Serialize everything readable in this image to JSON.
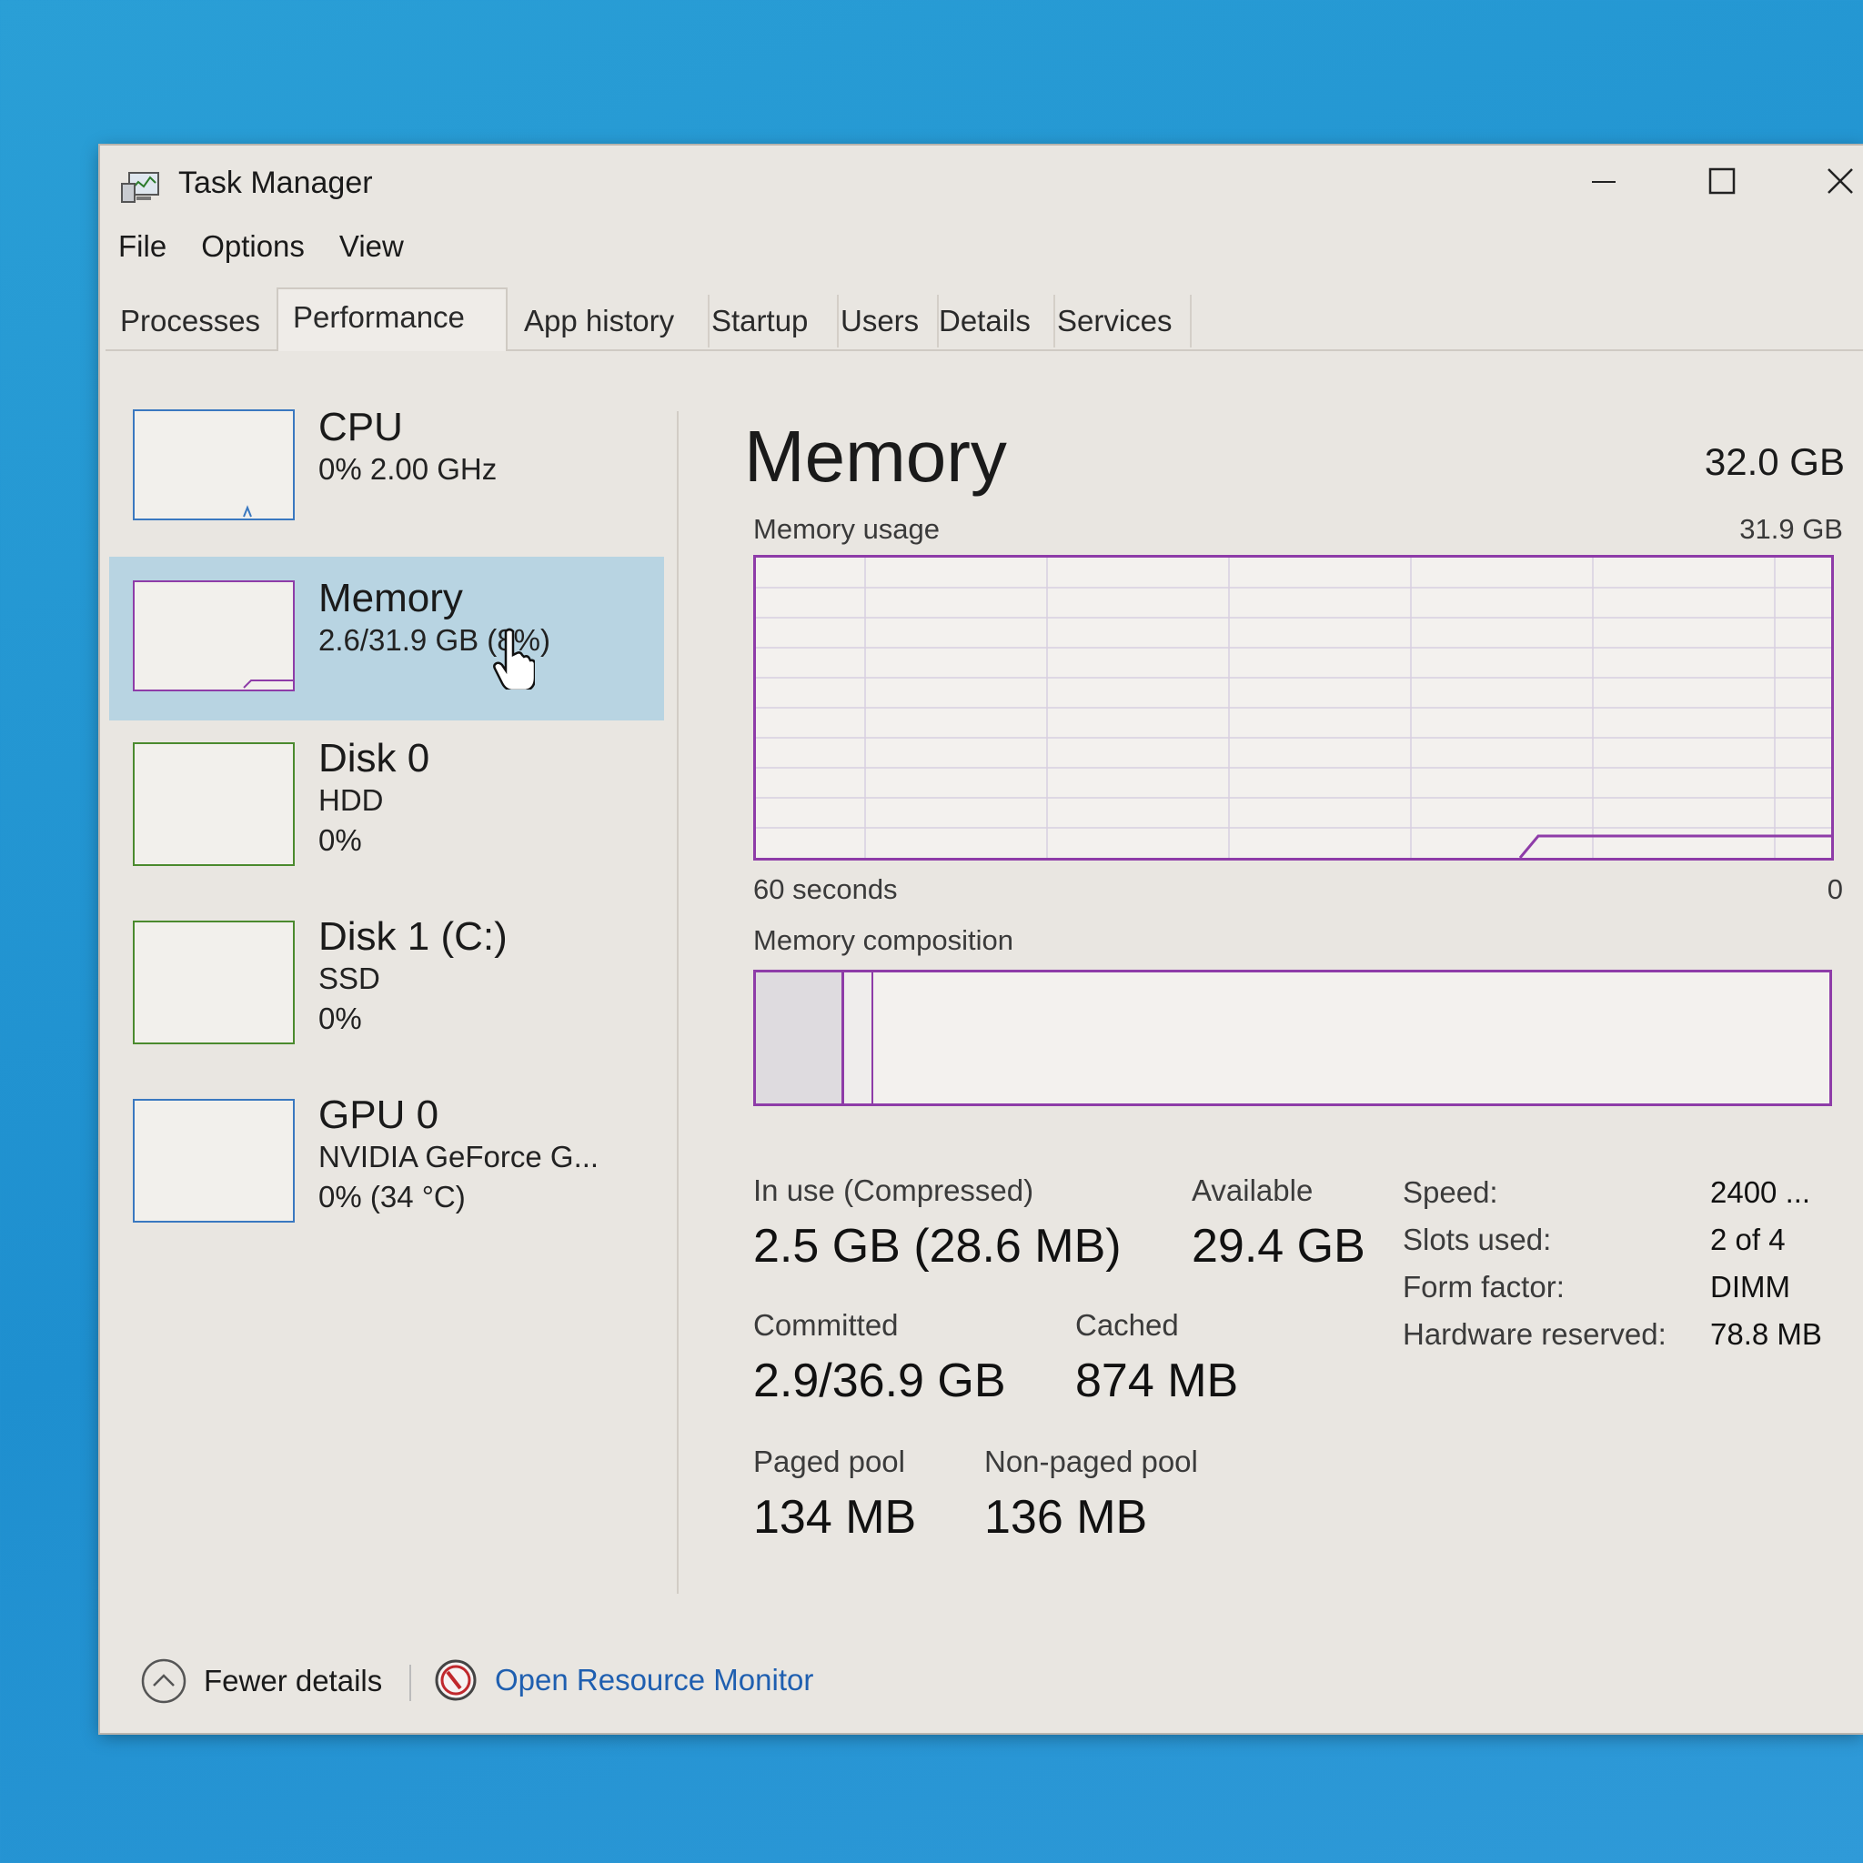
{
  "window": {
    "title": "Task Manager"
  },
  "menu": [
    "File",
    "Options",
    "View"
  ],
  "tabs": [
    "Processes",
    "Performance",
    "App history",
    "Startup",
    "Users",
    "Details",
    "Services"
  ],
  "sidebar": {
    "items": [
      {
        "name": "CPU",
        "line1": "0% 2.00 GHz",
        "line2": "",
        "border_color": "#3a78c0"
      },
      {
        "name": "Memory",
        "line1": "2.6/31.9 GB (8%)",
        "line2": "",
        "border_color": "#8e3ca8",
        "selected": true
      },
      {
        "name": "Disk 0",
        "line1": "HDD",
        "line2": "0%",
        "border_color": "#4b8a2e"
      },
      {
        "name": "Disk 1 (C:)",
        "line1": "SSD",
        "line2": "0%",
        "border_color": "#4b8a2e"
      },
      {
        "name": "GPU 0",
        "line1": "NVIDIA GeForce G...",
        "line2": "0% (34 °C)",
        "border_color": "#3a78c0"
      }
    ]
  },
  "main": {
    "title": "Memory",
    "total": "32.0 GB",
    "usage_label": "Memory usage",
    "usage_max": "31.9 GB",
    "time_left": "60 seconds",
    "time_right": "0",
    "composition_label": "Memory composition",
    "stats": {
      "in_use_label": "In use (Compressed)",
      "in_use_value": "2.5 GB (28.6 MB)",
      "available_label": "Available",
      "available_value": "29.4 GB",
      "committed_label": "Committed",
      "committed_value": "2.9/36.9 GB",
      "cached_label": "Cached",
      "cached_value": "874 MB",
      "paged_label": "Paged pool",
      "paged_value": "134 MB",
      "nonpaged_label": "Non-paged pool",
      "nonpaged_value": "136 MB"
    },
    "specs": [
      {
        "label": "Speed:",
        "value": "2400 ..."
      },
      {
        "label": "Slots used:",
        "value": "2 of 4"
      },
      {
        "label": "Form factor:",
        "value": "DIMM"
      },
      {
        "label": "Hardware reserved:",
        "value": "78.8 MB"
      }
    ]
  },
  "footer": {
    "fewer_details": "Fewer details",
    "resource_monitor": "Open Resource Monitor"
  },
  "colors": {
    "memory_accent": "#8e3ca8",
    "selected_bg": "#b8d4e2",
    "link": "#1f5fb0"
  }
}
